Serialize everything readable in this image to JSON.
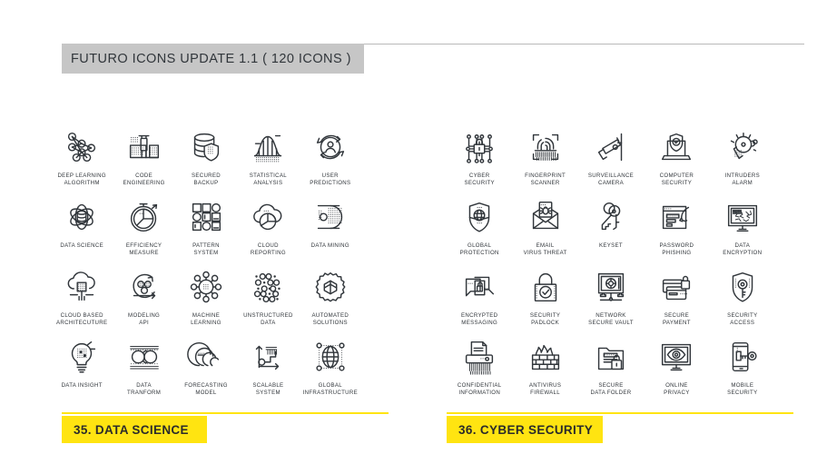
{
  "header": {
    "title": "FUTURO ICONS UPDATE 1.1 ( 120 ICONS )",
    "bar_color": "#c6c6c6",
    "rule_color": "#b9b9b9"
  },
  "theme": {
    "accent": "#ffe411",
    "ink": "#31363b",
    "background": "#ffffff"
  },
  "panels": [
    {
      "id": "data-science",
      "footer": {
        "number": "35.",
        "label": "35. DATA SCIENCE"
      },
      "icons": [
        {
          "icon": "neural-network-icon",
          "label": "DEEP LEARNING\nALGORITHM"
        },
        {
          "icon": "code-engineering-icon",
          "label": "CODE\nENGINEERING"
        },
        {
          "icon": "secured-backup-icon",
          "label": "SECURED\nBACKUP"
        },
        {
          "icon": "bell-curve-icon",
          "label": "STATISTICAL\nANALYSIS"
        },
        {
          "icon": "user-predictions-icon",
          "label": "USER\nPREDICTIONS"
        },
        {
          "icon": "atom-database-icon",
          "label": "DATA SCIENCE"
        },
        {
          "icon": "stopwatch-pie-icon",
          "label": "EFFICIENCY\nMEASURE"
        },
        {
          "icon": "pattern-grid-icon",
          "label": "PATTERN\nSYSTEM"
        },
        {
          "icon": "cloud-pie-icon",
          "label": "CLOUD\nREPORTING"
        },
        {
          "icon": "data-mining-icon",
          "label": "DATA MINING"
        },
        {
          "icon": "cloud-chip-icon",
          "label": "CLOUD BASED\nARCHITECUTURE"
        },
        {
          "icon": "modeling-api-icon",
          "label": "MODELING\nAPI"
        },
        {
          "icon": "machine-learning-icon",
          "label": "MACHINE\nLEARNING"
        },
        {
          "icon": "unstructured-dots-icon",
          "label": "UNSTRUCTURED\nDATA"
        },
        {
          "icon": "gear-cube-icon",
          "label": "AUTOMATED\nSOLUTIONS"
        },
        {
          "icon": "lightbulb-data-icon",
          "label": "DATA INSIGHT"
        },
        {
          "icon": "infinity-transform-icon",
          "label": "DATA\nTRANFORM"
        },
        {
          "icon": "forecasting-spiral-icon",
          "label": "FORECASTING\nMODEL"
        },
        {
          "icon": "scalable-chart-icon",
          "label": "SCALABLE\nSYSTEM"
        },
        {
          "icon": "globe-infrastructure-icon",
          "label": "GLOBAL\nINFRASTRUCTURE"
        }
      ]
    },
    {
      "id": "cyber-security",
      "footer": {
        "number": "36.",
        "label": "36. CYBER SECURITY"
      },
      "icons": [
        {
          "icon": "circuit-lock-icon",
          "label": "CYBER\nSECURITY"
        },
        {
          "icon": "fingerprint-scanner-icon",
          "label": "FINGERPRINT\nSCANNER"
        },
        {
          "icon": "cctv-camera-icon",
          "label": "SURVEILLANCE\nCAMERA"
        },
        {
          "icon": "laptop-shield-icon",
          "label": "COMPUTER\nSECURITY"
        },
        {
          "icon": "alarm-bell-icon",
          "label": "INTRUDERS\nALARM"
        },
        {
          "icon": "shield-globe-icon",
          "label": "GLOBAL\nPROTECTION"
        },
        {
          "icon": "email-virus-icon",
          "label": "EMAIL\nVIRUS THREAT"
        },
        {
          "icon": "keyset-icon",
          "label": "KEYSET"
        },
        {
          "icon": "password-phishing-icon",
          "label": "PASSWORD\nPHISHING"
        },
        {
          "icon": "monitor-encryption-icon",
          "label": "DATA\nENCRYPTION"
        },
        {
          "icon": "encrypted-chat-icon",
          "label": "ENCRYPTED\nMESSAGING"
        },
        {
          "icon": "padlock-check-icon",
          "label": "SECURITY\nPADLOCK"
        },
        {
          "icon": "secure-vault-icon",
          "label": "NETWORK\nSECURE VAULT"
        },
        {
          "icon": "card-lock-icon",
          "label": "SECURE\nPAYMENT"
        },
        {
          "icon": "shield-key-icon",
          "label": "SECURITY\nACCESS"
        },
        {
          "icon": "shredder-icon",
          "label": "CONFIDENTIAL\nINFORMATION"
        },
        {
          "icon": "firewall-icon",
          "label": "ANTIVIRUS\nFIREWALL"
        },
        {
          "icon": "folder-lock-icon",
          "label": "SECURE\nDATA FOLDER"
        },
        {
          "icon": "monitor-eye-icon",
          "label": "ONLINE\nPRIVACY"
        },
        {
          "icon": "mobile-key-icon",
          "label": "MOBILE\nSECURITY"
        }
      ]
    }
  ]
}
